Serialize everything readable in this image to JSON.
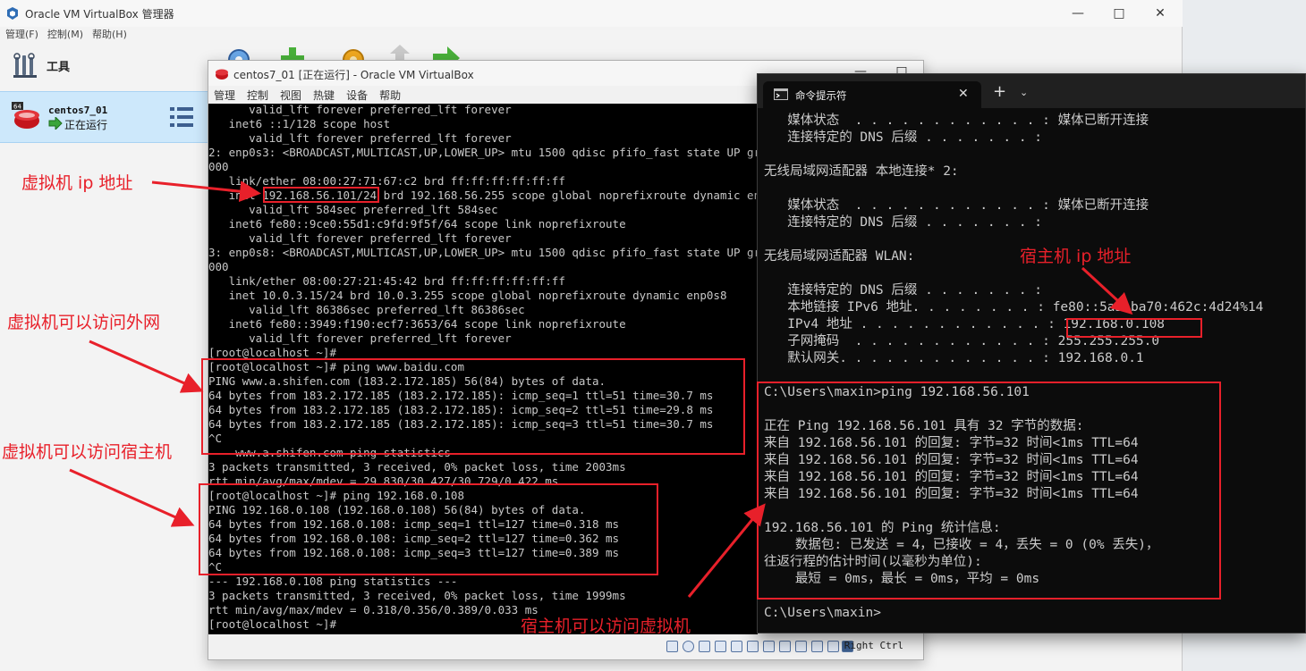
{
  "manager": {
    "title": "Oracle VM VirtualBox 管理器",
    "menu": [
      "管理(F)",
      "控制(M)",
      "帮助(H)"
    ],
    "tools_label": "工具",
    "vm": {
      "name": "centos7_01",
      "state": "正在运行",
      "badge": "64"
    }
  },
  "vm_window": {
    "title": "centos7_01 [正在运行] - Oracle VM VirtualBox",
    "menu": [
      "管理",
      "控制",
      "视图",
      "热键",
      "设备",
      "帮助"
    ],
    "host_key": "Right Ctrl",
    "console_lines": [
      "      valid_lft forever preferred_lft forever",
      "   inet6 ::1/128 scope host",
      "      valid_lft forever preferred_lft forever",
      "2: enp0s3: <BROADCAST,MULTICAST,UP,LOWER_UP> mtu 1500 qdisc pfifo_fast state UP group default qlen 1",
      "000",
      "   link/ether 08:00:27:71:67:c2 brd ff:ff:ff:ff:ff:ff",
      "   inet 192.168.56.101/24 brd 192.168.56.255 scope global noprefixroute dynamic enp0s3",
      "      valid_lft 584sec preferred_lft 584sec",
      "   inet6 fe80::9ce0:55d1:c9fd:9f5f/64 scope link noprefixroute",
      "      valid_lft forever preferred_lft forever",
      "3: enp0s8: <BROADCAST,MULTICAST,UP,LOWER_UP> mtu 1500 qdisc pfifo_fast state UP group default qlen 1",
      "000",
      "   link/ether 08:00:27:21:45:42 brd ff:ff:ff:ff:ff:ff",
      "   inet 10.0.3.15/24 brd 10.0.3.255 scope global noprefixroute dynamic enp0s8",
      "      valid_lft 86386sec preferred_lft 86386sec",
      "   inet6 fe80::3949:f190:ecf7:3653/64 scope link noprefixroute",
      "      valid_lft forever preferred_lft forever",
      "[root@localhost ~]#",
      "[root@localhost ~]# ping www.baidu.com",
      "PING www.a.shifen.com (183.2.172.185) 56(84) bytes of data.",
      "64 bytes from 183.2.172.185 (183.2.172.185): icmp_seq=1 ttl=51 time=30.7 ms",
      "64 bytes from 183.2.172.185 (183.2.172.185): icmp_seq=2 ttl=51 time=29.8 ms",
      "64 bytes from 183.2.172.185 (183.2.172.185): icmp_seq=3 ttl=51 time=30.7 ms",
      "^C",
      "--- www.a.shifen.com ping statistics ---",
      "3 packets transmitted, 3 received, 0% packet loss, time 2003ms",
      "rtt min/avg/max/mdev = 29.830/30.427/30.729/0.422 ms",
      "[root@localhost ~]# ping 192.168.0.108",
      "PING 192.168.0.108 (192.168.0.108) 56(84) bytes of data.",
      "64 bytes from 192.168.0.108: icmp_seq=1 ttl=127 time=0.318 ms",
      "64 bytes from 192.168.0.108: icmp_seq=2 ttl=127 time=0.362 ms",
      "64 bytes from 192.168.0.108: icmp_seq=3 ttl=127 time=0.389 ms",
      "^C",
      "--- 192.168.0.108 ping statistics ---",
      "3 packets transmitted, 3 received, 0% packet loss, time 1999ms",
      "rtt min/avg/max/mdev = 0.318/0.356/0.389/0.033 ms",
      "[root@localhost ~]#"
    ]
  },
  "terminal": {
    "tab_title": "命令提示符",
    "lines": [
      "   媒体状态  . . . . . . . . . . . . : 媒体已断开连接",
      "   连接特定的 DNS 后缀 . . . . . . . :",
      "",
      "无线局域网适配器 本地连接* 2:",
      "",
      "   媒体状态  . . . . . . . . . . . . : 媒体已断开连接",
      "   连接特定的 DNS 后缀 . . . . . . . :",
      "",
      "无线局域网适配器 WLAN:",
      "",
      "   连接特定的 DNS 后缀 . . . . . . . :",
      "   本地链接 IPv6 地址. . . . . . . . : fe80::5a3:ba70:462c:4d24%14",
      "   IPv4 地址 . . . . . . . . . . . . : 192.168.0.108",
      "   子网掩码  . . . . . . . . . . . . : 255.255.255.0",
      "   默认网关. . . . . . . . . . . . . : 192.168.0.1",
      "",
      "C:\\Users\\maxin>ping 192.168.56.101",
      "",
      "正在 Ping 192.168.56.101 具有 32 字节的数据:",
      "来自 192.168.56.101 的回复: 字节=32 时间<1ms TTL=64",
      "来自 192.168.56.101 的回复: 字节=32 时间<1ms TTL=64",
      "来自 192.168.56.101 的回复: 字节=32 时间<1ms TTL=64",
      "来自 192.168.56.101 的回复: 字节=32 时间<1ms TTL=64",
      "",
      "192.168.56.101 的 Ping 统计信息:",
      "    数据包: 已发送 = 4，已接收 = 4，丢失 = 0 (0% 丢失)，",
      "往返行程的估计时间(以毫秒为单位):",
      "    最短 = 0ms，最长 = 0ms，平均 = 0ms",
      "",
      "C:\\Users\\maxin>"
    ]
  },
  "annotations": {
    "vm_ip": "虚拟机 ip 地址",
    "vm_internet": "虚拟机可以访问外网",
    "vm_to_host": "虚拟机可以访问宿主机",
    "host_ip": "宿主机 ip 地址",
    "host_to_vm": "宿主机可以访问虚拟机"
  },
  "colors": {
    "annotation": "#e8202a",
    "vm_selected": "#cde8fb",
    "console_bg": "#000000",
    "terminal_bg": "#0c0c0c"
  }
}
